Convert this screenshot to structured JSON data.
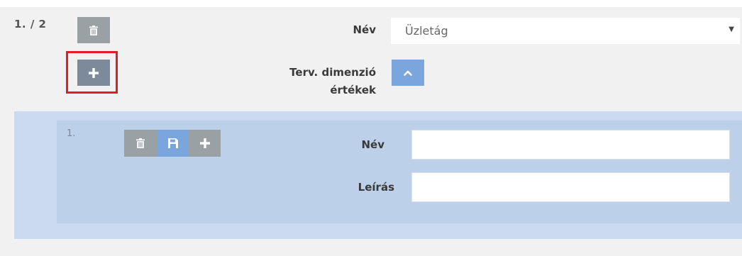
{
  "row": {
    "index": "1. / 2",
    "fields": {
      "nev_label": "Név",
      "nev_value": "Üzletág",
      "terv_label_line1": "Terv. dimenzió",
      "terv_label_line2": "értékek"
    }
  },
  "sub_item": {
    "index": "1.",
    "fields": {
      "nev_label": "Név",
      "nev_value": "",
      "leiras_label": "Leírás",
      "leiras_value": ""
    }
  },
  "colors": {
    "panel_bg": "#f1f1f1",
    "sub_outer_bg": "#cbdaf0",
    "sub_inner_bg": "#bcd0ea",
    "gray_button": "#9aa1a5",
    "blue_button": "#7aa6dd",
    "highlight": "#e21c23"
  },
  "icons": {
    "delete": "trash-icon",
    "add": "plus-icon",
    "save": "save-icon",
    "collapse": "chevron-up-icon",
    "dropdown": "caret-down-icon"
  }
}
